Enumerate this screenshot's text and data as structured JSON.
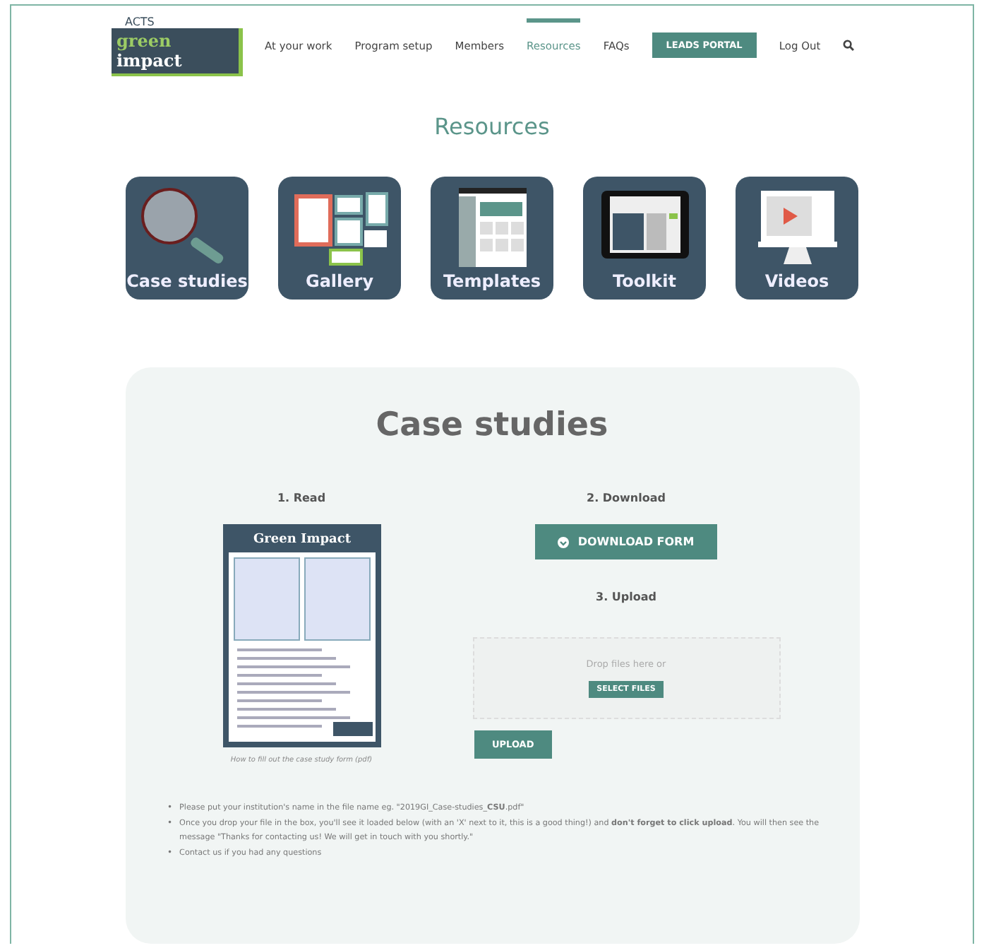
{
  "logo": {
    "top": "ACTS",
    "left": "green",
    "right": "impact"
  },
  "nav": [
    {
      "label": "At your work",
      "selected": false
    },
    {
      "label": "Program setup",
      "selected": false
    },
    {
      "label": "Members",
      "selected": false
    },
    {
      "label": "Resources",
      "selected": true
    },
    {
      "label": "FAQs",
      "selected": false
    }
  ],
  "portal_button": "LEADS PORTAL",
  "logout": "Log Out",
  "page_title": "Resources",
  "tiles": [
    {
      "label": "Case studies",
      "kind": "magnifier"
    },
    {
      "label": "Gallery",
      "kind": "gallery"
    },
    {
      "label": "Templates",
      "kind": "template"
    },
    {
      "label": "Toolkit",
      "kind": "tablet"
    },
    {
      "label": "Videos",
      "kind": "monitor"
    }
  ],
  "panel": {
    "title": "Case studies",
    "read": {
      "heading": "1. Read",
      "doc_title": "Green Impact",
      "caption": "How to fill out the case study form (pdf)"
    },
    "download": {
      "heading": "2. Download",
      "button": "DOWNLOAD FORM"
    },
    "upload": {
      "heading": "3. Upload",
      "drop_text": "Drop files here or",
      "select_button": "SELECT FILES",
      "upload_button": "UPLOAD"
    },
    "notes": [
      {
        "bullet": "•",
        "text": "Please put your institution's name in the file name eg. \"2019GI_Case-studies_**CSU**.pdf\""
      },
      {
        "bullet": "•",
        "text": "Once you drop your file in the box, you'll see it loaded below (with an 'X' next to it, this is a good thing!) and **don't forget to click upload**. You will then see the message \"Thanks for contacting us! We will get in touch with you shortly.\""
      },
      {
        "bullet": "•",
        "text": "Contact us if you had any questions"
      }
    ]
  }
}
